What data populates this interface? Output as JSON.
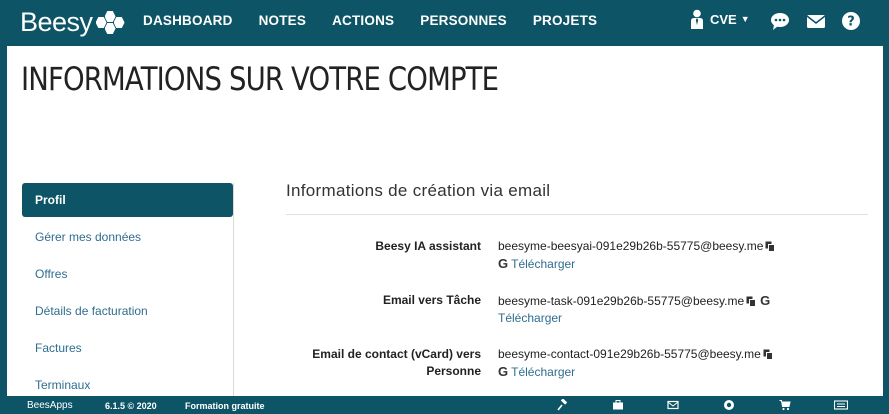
{
  "app": {
    "logo_text": "Beesy",
    "nav": [
      "DASHBOARD",
      "NOTES",
      "ACTIONS",
      "PERSONNES",
      "PROJETS"
    ],
    "user": "CVE"
  },
  "page": {
    "title": "INFORMATIONS SUR VOTRE COMPTE"
  },
  "sidebar": {
    "items": [
      {
        "label": "Profil",
        "active": true
      },
      {
        "label": "Gérer mes données",
        "active": false
      },
      {
        "label": "Offres",
        "active": false
      },
      {
        "label": "Détails de facturation",
        "active": false
      },
      {
        "label": "Factures",
        "active": false
      },
      {
        "label": "Terminaux",
        "active": false
      }
    ]
  },
  "content": {
    "section_title": "Informations de création via email",
    "rows": [
      {
        "label": "Beesy IA assistant",
        "email": "beesyme-beesyai-091e29b26b-55775@beesy.me",
        "link": "Télécharger"
      },
      {
        "label": "Email vers Tâche",
        "email": "beesyme-task-091e29b26b-55775@beesy.me",
        "link": "Télécharger"
      },
      {
        "label": "Email de contact (vCard) vers Personne",
        "email": "beesyme-contact-091e29b26b-55775@beesy.me",
        "link": "Télécharger"
      }
    ]
  },
  "footer": {
    "brand": "BeesApps",
    "version": "6.1.5 © 2020",
    "training": "Formation gratuite"
  },
  "colors": {
    "primary": "#0d5566",
    "link": "#2f6d90"
  },
  "icons": [
    "chat-icon",
    "mail-icon",
    "help-icon",
    "copy-icon",
    "google-icon",
    "gavel-icon",
    "briefcase-icon",
    "envelope-icon",
    "lifebuoy-icon",
    "cart-icon",
    "keyboard-icon"
  ]
}
